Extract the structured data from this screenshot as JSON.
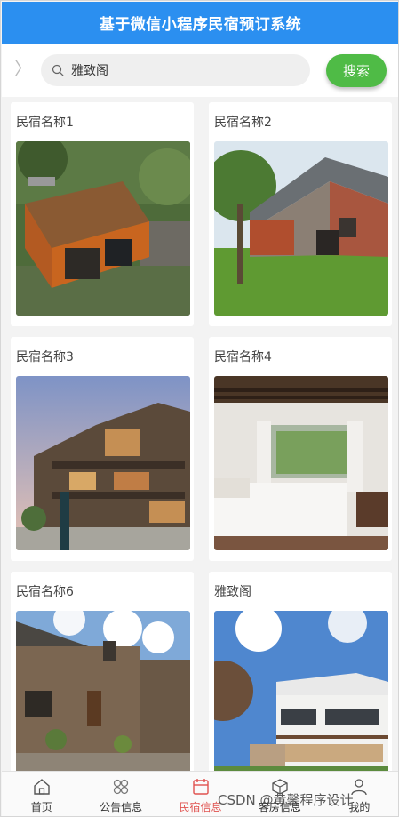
{
  "header": {
    "title": "基于微信小程序民宿预订系统"
  },
  "search": {
    "value": "雅致阁",
    "button_label": "搜索"
  },
  "listings": [
    {
      "name": "民宿名称1"
    },
    {
      "name": "民宿名称2"
    },
    {
      "name": "民宿名称3"
    },
    {
      "name": "民宿名称4"
    },
    {
      "name": "民宿名称6"
    },
    {
      "name": "雅致阁"
    }
  ],
  "tabbar": {
    "items": [
      {
        "label": "首页",
        "icon": "home-icon"
      },
      {
        "label": "公告信息",
        "icon": "grid-icon"
      },
      {
        "label": "民宿信息",
        "icon": "calendar-icon",
        "active": true
      },
      {
        "label": "客房信息",
        "icon": "cube-icon"
      },
      {
        "label": "我的",
        "icon": "user-icon"
      }
    ],
    "active_color": "#e0524f"
  },
  "watermark": "CSDN @黄馨程序设计",
  "colors": {
    "header": "#2b8ff0",
    "search_button": "#4fbb46"
  }
}
